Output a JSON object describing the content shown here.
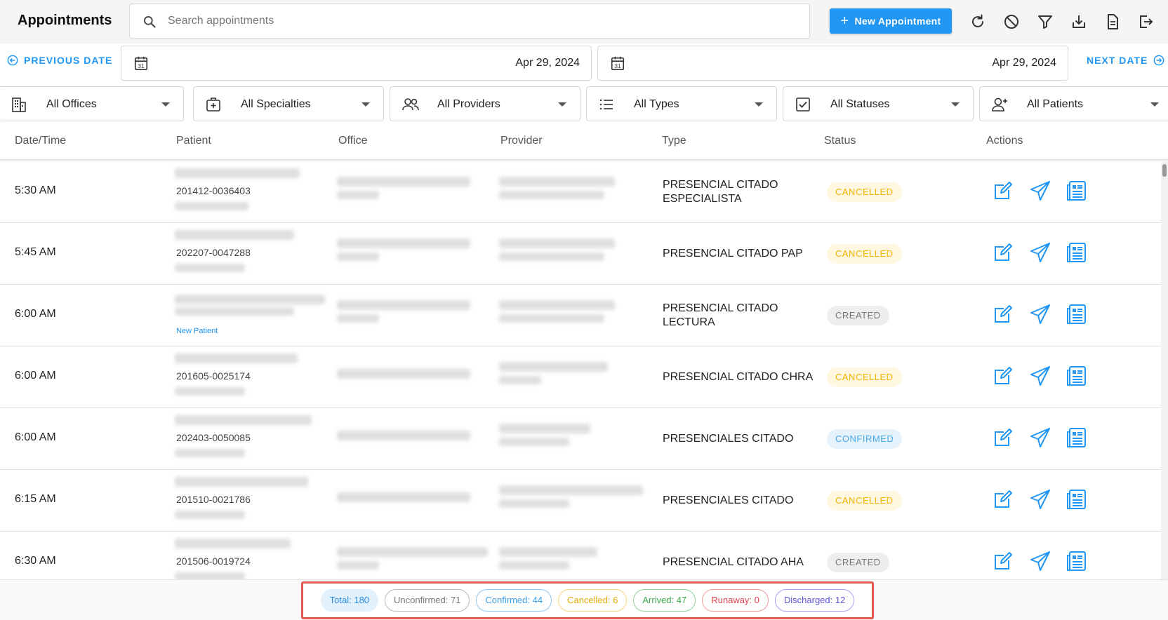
{
  "header": {
    "title": "Appointments",
    "search_placeholder": "Search appointments",
    "new_button": "New Appointment",
    "toolbar_icons": [
      "refresh-icon",
      "block-icon",
      "filter-icon",
      "download-icon",
      "document-icon",
      "logout-icon"
    ]
  },
  "datebar": {
    "prev_label": "PREVIOUS DATE",
    "next_label": "NEXT DATE",
    "start_date": "Apr 29, 2024",
    "end_date": "Apr 29, 2024"
  },
  "filters": {
    "offices": "All Offices",
    "specialties": "All Specialties",
    "providers": "All Providers",
    "types": "All Types",
    "statuses": "All Statuses",
    "patients": "All Patients"
  },
  "table": {
    "columns": {
      "datetime": "Date/Time",
      "patient": "Patient",
      "office": "Office",
      "provider": "Provider",
      "type": "Type",
      "status": "Status",
      "actions": "Actions"
    },
    "rows": [
      {
        "time": "5:30 AM",
        "patient_id": "201412-0036403",
        "type_line1": "PRESENCIAL CITADO",
        "type_line2": "ESPECIALISTA",
        "status": "CANCELLED"
      },
      {
        "time": "5:45 AM",
        "patient_id": "202207-0047288",
        "type_line1": "PRESENCIAL CITADO PAP",
        "type_line2": "",
        "status": "CANCELLED"
      },
      {
        "time": "6:00 AM",
        "patient_id": "",
        "new_patient": "New Patient",
        "type_line1": "PRESENCIAL CITADO",
        "type_line2": "LECTURA",
        "status": "CREATED"
      },
      {
        "time": "6:00 AM",
        "patient_id": "201605-0025174",
        "type_line1": "PRESENCIAL CITADO CHRA",
        "type_line2": "",
        "status": "CANCELLED"
      },
      {
        "time": "6:00 AM",
        "patient_id": "202403-0050085",
        "type_line1": "PRESENCIALES CITADO",
        "type_line2": "",
        "status": "CONFIRMED"
      },
      {
        "time": "6:15 AM",
        "patient_id": "201510-0021786",
        "type_line1": "PRESENCIALES CITADO",
        "type_line2": "",
        "status": "CANCELLED"
      },
      {
        "time": "6:30 AM",
        "patient_id": "201506-0019724",
        "type_line1": "PRESENCIAL CITADO AHA",
        "type_line2": "",
        "status": "CREATED"
      }
    ]
  },
  "summary": {
    "total": "Total: 180",
    "unconfirmed": "Unconfirmed: 71",
    "confirmed": "Confirmed: 44",
    "cancelled": "Cancelled: 6",
    "arrived": "Arrived: 47",
    "runaway": "Runaway: 0",
    "discharged": "Discharged: 12"
  },
  "colors": {
    "accent": "#2196f3",
    "cancelled": "#f0b400",
    "confirmed": "#4aa8e8",
    "highlight_border": "#e05a4f"
  }
}
